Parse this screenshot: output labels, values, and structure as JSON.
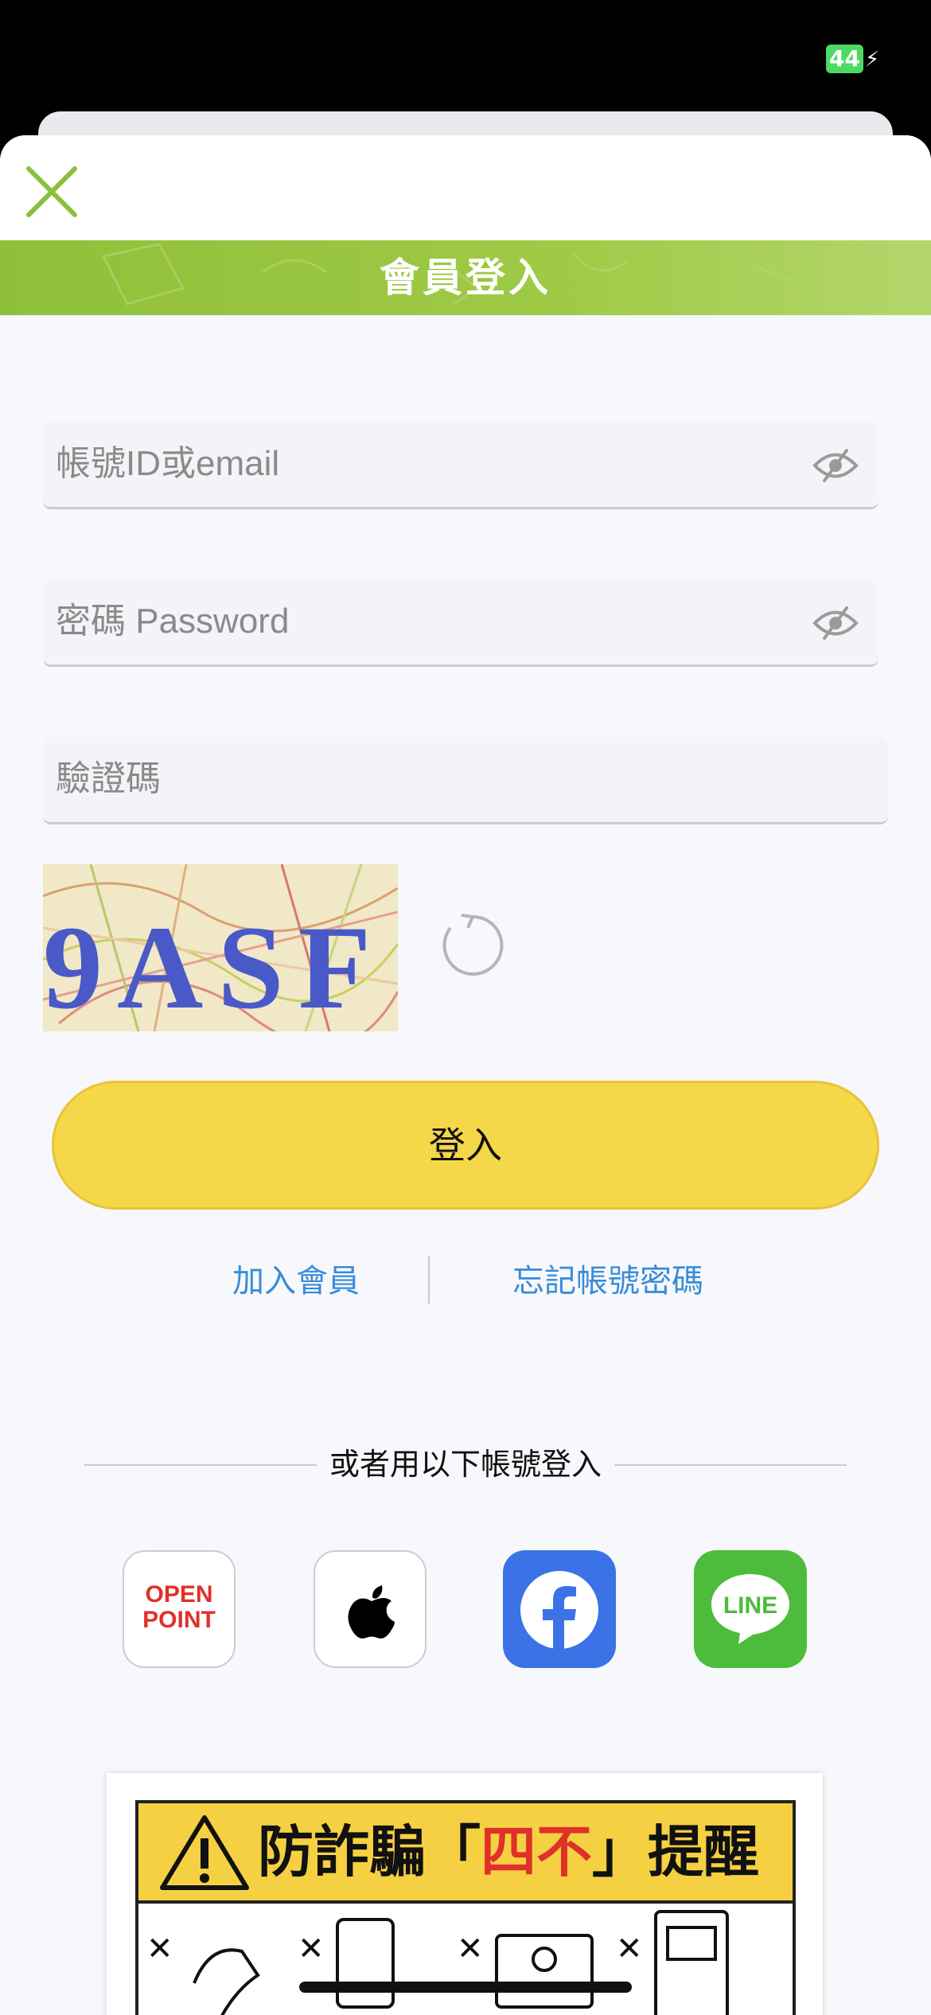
{
  "status_bar": {
    "battery": "44"
  },
  "header": {
    "title": "會員登入"
  },
  "form": {
    "account_placeholder": "帳號ID或email",
    "password_placeholder": "密碼 Password",
    "captcha_placeholder": "驗證碼",
    "captcha_text": "9ASF",
    "login_label": "登入"
  },
  "links": {
    "join": "加入會員",
    "forgot": "忘記帳號密碼"
  },
  "social": {
    "heading": "或者用以下帳號登入",
    "openpoint_line1": "OPEN",
    "openpoint_line2": "POINT",
    "line_label": "LINE"
  },
  "notice": {
    "title_prefix": "防詐騙「",
    "title_highlight": "四不",
    "title_suffix": "」提醒"
  },
  "colors": {
    "brand_green": "#9bc844",
    "button_yellow": "#f5d74a",
    "link_blue": "#3b8bd8",
    "facebook": "#3b73e6",
    "line": "#4dbb3b"
  }
}
